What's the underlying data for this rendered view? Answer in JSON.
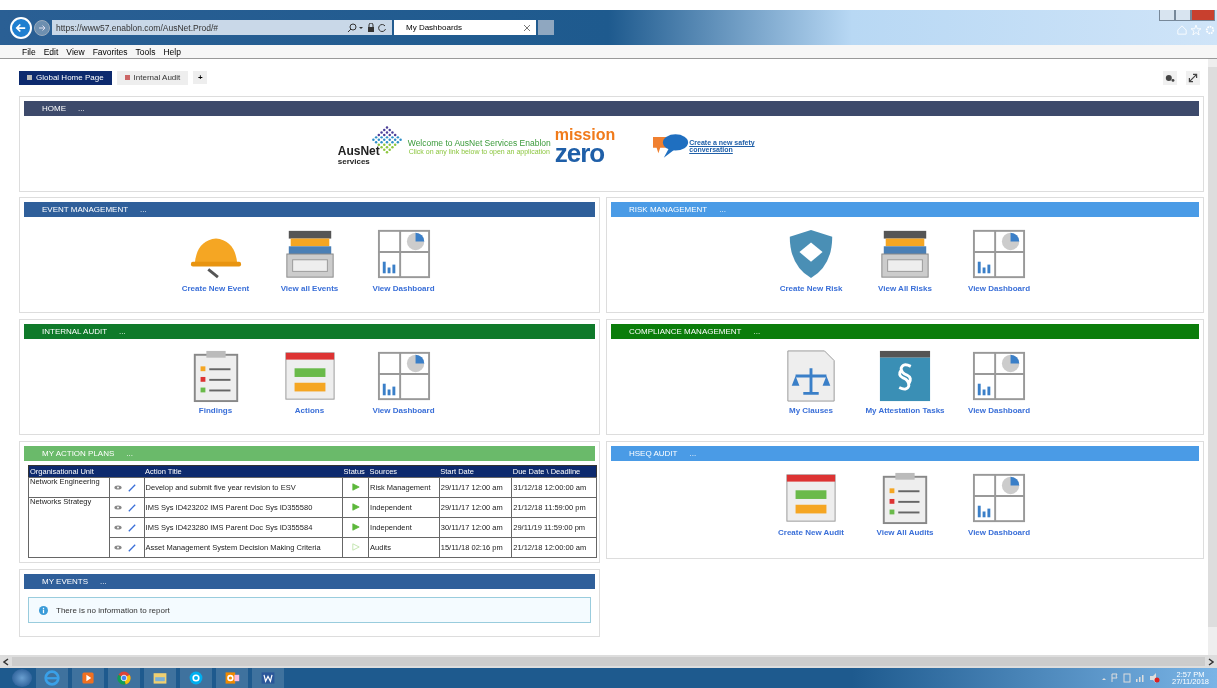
{
  "browser": {
    "url": "https://www57.enablon.com/AusNet.Prod/#",
    "tab": "My Dashboards",
    "menu": [
      "File",
      "Edit",
      "View",
      "Favorites",
      "Tools",
      "Help"
    ]
  },
  "page_tabs": [
    {
      "label": "Global Home Page",
      "selected": true
    },
    {
      "label": "Internal Audit",
      "selected": false
    }
  ],
  "add_tab": "+",
  "home": {
    "title": "HOME",
    "more": "...",
    "logo_name": "AusNet",
    "logo_sub": "services",
    "welcome": "Welcome to AusNet Services Enablon",
    "hint": "Click on any link below to open an application",
    "mission": "mission",
    "zero": "zero",
    "link": "Create a new safety conversation"
  },
  "panels": [
    {
      "title": "EVENT MANAGEMENT",
      "more": "...",
      "color": "#2f5f9a",
      "items": [
        {
          "kind": "helmet",
          "label": "Create New Event"
        },
        {
          "kind": "tray",
          "label": "View all Events"
        },
        {
          "kind": "dashboard",
          "label": "View Dashboard"
        }
      ]
    },
    {
      "title": "RISK MANAGEMENT",
      "more": "...",
      "color": "#4a9be6",
      "items": [
        {
          "kind": "shield",
          "label": "Create New Risk"
        },
        {
          "kind": "tray",
          "label": "View All Risks"
        },
        {
          "kind": "dashboard",
          "label": "View Dashboard"
        }
      ]
    },
    {
      "title": "INTERNAL AUDIT",
      "more": "...",
      "color": "#0f7a2a",
      "items": [
        {
          "kind": "clipboard",
          "label": "Findings"
        },
        {
          "kind": "actions",
          "label": "Actions"
        },
        {
          "kind": "dashboard",
          "label": "View Dashboard"
        }
      ]
    },
    {
      "title": "COMPLIANCE MANAGEMENT",
      "more": "...",
      "color": "#0b7d0b",
      "items": [
        {
          "kind": "scales",
          "label": "My Clauses"
        },
        {
          "kind": "section",
          "label": "My Attestation Tasks"
        },
        {
          "kind": "dashboard",
          "label": "View Dashboard"
        }
      ]
    }
  ],
  "action_plans": {
    "title": "MY ACTION PLANS",
    "more": "...",
    "color": "#6aba6a",
    "columns": [
      "Organisational Unit",
      "",
      "Action Title",
      "Status",
      "Sources",
      "Start Date",
      "Due Date \\ Deadline"
    ],
    "groups": [
      {
        "unit": "Network Engineering",
        "rows": [
          {
            "title": "Develop and submit five year revision to ESV",
            "started": true,
            "source": "Risk Management",
            "start": "29/11/17 12:00 am",
            "due": "31/12/18 12:00:00 am"
          }
        ]
      },
      {
        "unit": "Networks Strategy",
        "rows": [
          {
            "title": "IMS Sys ID423202 IMS Parent Doc Sys ID355580",
            "started": true,
            "source": "Independent",
            "start": "29/11/17 12:00 am",
            "due": "21/12/18 11:59:00 pm"
          },
          {
            "title": "IMS Sys ID423280 IMS Parent Doc Sys ID355584",
            "started": true,
            "source": "Independent",
            "start": "30/11/17 12:00 am",
            "due": "29/11/19 11:59:00 pm"
          },
          {
            "title": "Asset Management System Decision Making Criteria",
            "started": false,
            "source": "Audits",
            "start": "15/11/18 02:16 pm",
            "due": "21/12/18 12:00:00 am"
          }
        ]
      }
    ]
  },
  "hseq": {
    "title": "HSEQ AUDIT",
    "more": "...",
    "color": "#4a9be6",
    "items": [
      {
        "kind": "actions",
        "label": "Create New Audit"
      },
      {
        "kind": "clipboard",
        "label": "View All Audits"
      },
      {
        "kind": "dashboard",
        "label": "View Dashboard"
      }
    ]
  },
  "events": {
    "title": "MY EVENTS",
    "more": "...",
    "color": "#2f5f9a",
    "message": "There is no information to report"
  },
  "taskbar": {
    "time": "2:57 PM",
    "date": "27/11/2018"
  }
}
